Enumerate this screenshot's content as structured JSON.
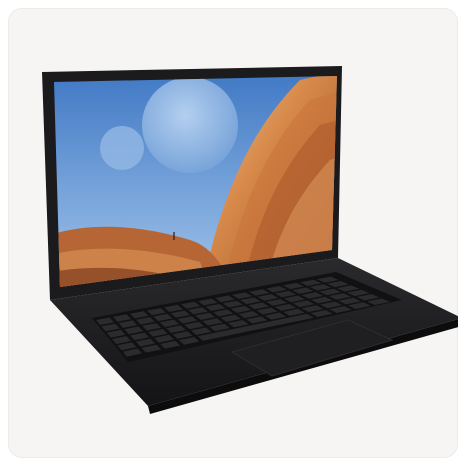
{
  "product": {
    "image_alt": "",
    "colors": {
      "card_bg": "#f6f5f4",
      "chassis": "#1d1d1f",
      "sky_blue": "#5d8fd0",
      "dune_orange": "#c8773a"
    }
  }
}
